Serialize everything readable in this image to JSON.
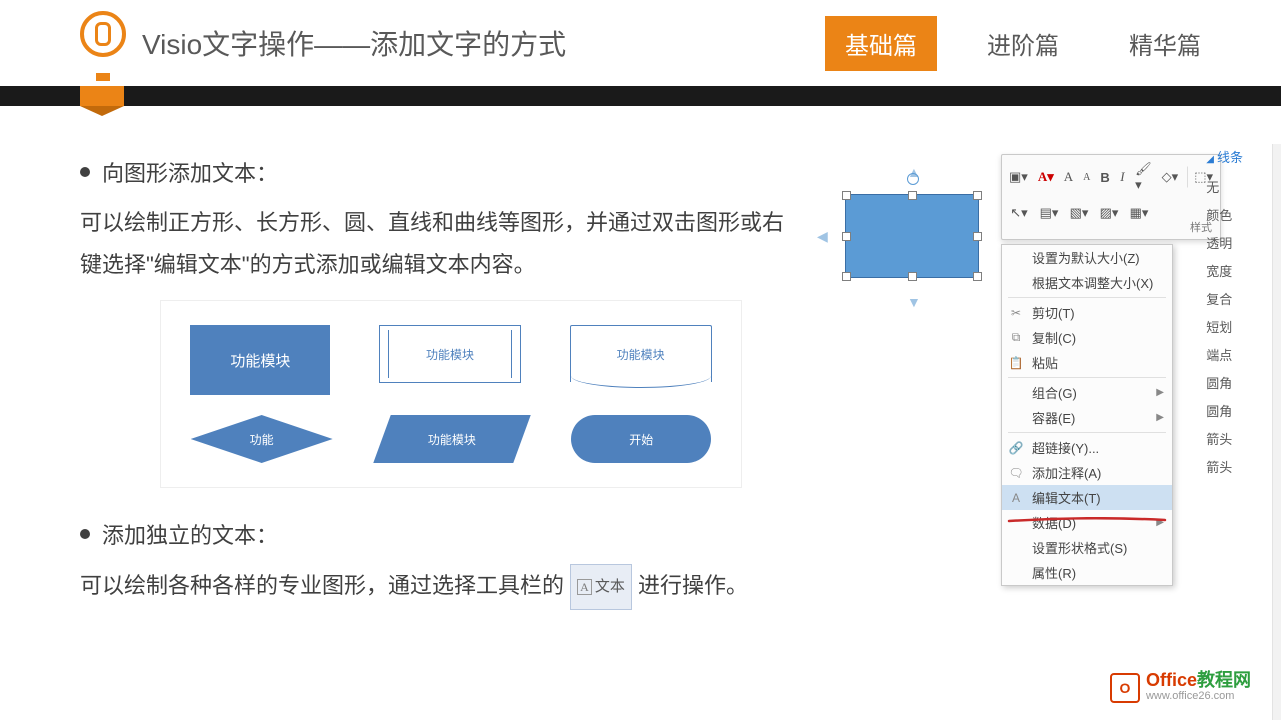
{
  "header": {
    "title": "Visio文字操作——添加文字的方式",
    "tabs": [
      "基础篇",
      "进阶篇",
      "精华篇"
    ],
    "activeTab": 0
  },
  "section1": {
    "bullet": "向图形添加文本：",
    "body": "可以绘制正方形、长方形、圆、直线和曲线等图形，并通过双击图形或右键选择\"编辑文本\"的方式添加或编辑文本内容。"
  },
  "shapes": {
    "rect": "功能模块",
    "outline": "功能模块",
    "wave": "功能模块",
    "diamond": "功能",
    "para": "功能模块",
    "pill": "开始"
  },
  "section2": {
    "bullet": "添加独立的文本：",
    "body_before": "可以绘制各种各样的专业图形，通过选择工具栏的",
    "body_btn_a": "A",
    "body_btn_label": "文本",
    "body_after": "进行操作。"
  },
  "minitool": {
    "style_label": "样式"
  },
  "context_menu": [
    {
      "label": "设置为默认大小(Z)",
      "icon": "",
      "arrow": false
    },
    {
      "label": "根据文本调整大小(X)",
      "icon": "",
      "arrow": false
    },
    {
      "sep": true
    },
    {
      "label": "剪切(T)",
      "icon": "✂",
      "arrow": false
    },
    {
      "label": "复制(C)",
      "icon": "⧉",
      "arrow": false
    },
    {
      "label": "粘贴",
      "icon": "📋",
      "arrow": false
    },
    {
      "sep": true
    },
    {
      "label": "组合(G)",
      "icon": "",
      "arrow": true
    },
    {
      "label": "容器(E)",
      "icon": "",
      "arrow": true
    },
    {
      "sep": true
    },
    {
      "label": "超链接(Y)...",
      "icon": "🔗",
      "arrow": false
    },
    {
      "label": "添加注释(A)",
      "icon": "🗨",
      "arrow": false
    },
    {
      "label": "编辑文本(T)",
      "icon": "A",
      "arrow": false,
      "highlight": true
    },
    {
      "label": "数据(D)",
      "icon": "",
      "arrow": true
    },
    {
      "label": "设置形状格式(S)",
      "icon": "",
      "arrow": false
    },
    {
      "label": "属性(R)",
      "icon": "",
      "arrow": false
    }
  ],
  "side_panel": {
    "header": "线条",
    "items": [
      "无",
      "",
      "",
      "颜色",
      "透明",
      "宽度",
      "复合",
      "短划",
      "端点",
      "圆角",
      "圆角",
      "箭头",
      "箭头"
    ]
  },
  "watermark": {
    "brand_left": "Office",
    "brand_right": "教程网",
    "url": "www.office26.com"
  }
}
